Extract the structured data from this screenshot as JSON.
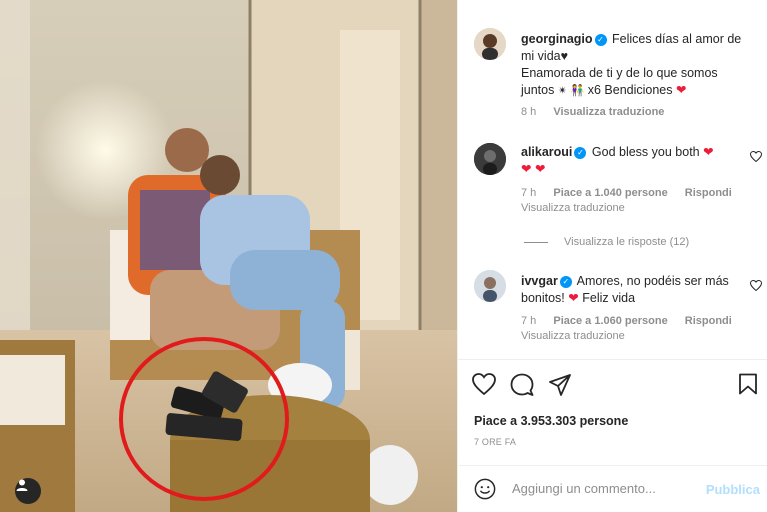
{
  "post": {
    "author": "georginagio",
    "caption_line1": "Felices días al amor de",
    "caption_line2": "mi vida♥",
    "caption_line3": "Enamorada de ti y de lo que somos",
    "caption_line4_a": "juntos",
    "caption_line4_b": "x6 Bendiciones",
    "caption_time": "8 h",
    "caption_translate": "Visualizza traduzione"
  },
  "comments": [
    {
      "username": "alikaroui",
      "text": "God bless you both",
      "time": "7 h",
      "likes": "Piace a 1.040 persone",
      "reply": "Rispondi",
      "translate": "Visualizza traduzione",
      "replies_label": "Visualizza le risposte (12)"
    },
    {
      "username": "ivvgar",
      "text_line1": "Amores, no podéis ser más",
      "text_line2_a": "bonitos!",
      "text_line2_b": "Feliz vida",
      "time": "7 h",
      "likes": "Piace a 1.060 persone",
      "reply": "Rispondi",
      "translate": "Visualizza traduzione"
    }
  ],
  "footer": {
    "likes": "Piace a 3.953.303 persone",
    "time_ago": "7 ORE FA",
    "comment_placeholder": "Aggiungi un commento...",
    "publish": "Pubblica"
  },
  "colors": {
    "verified": "#0095f6",
    "heart": "#ed1c3a",
    "circle": "#e11b1b",
    "publish": "#b2dffc"
  },
  "icons": [
    "heart-icon",
    "comment-icon",
    "share-icon",
    "bookmark-icon",
    "emoji-icon",
    "user-tag-icon"
  ]
}
